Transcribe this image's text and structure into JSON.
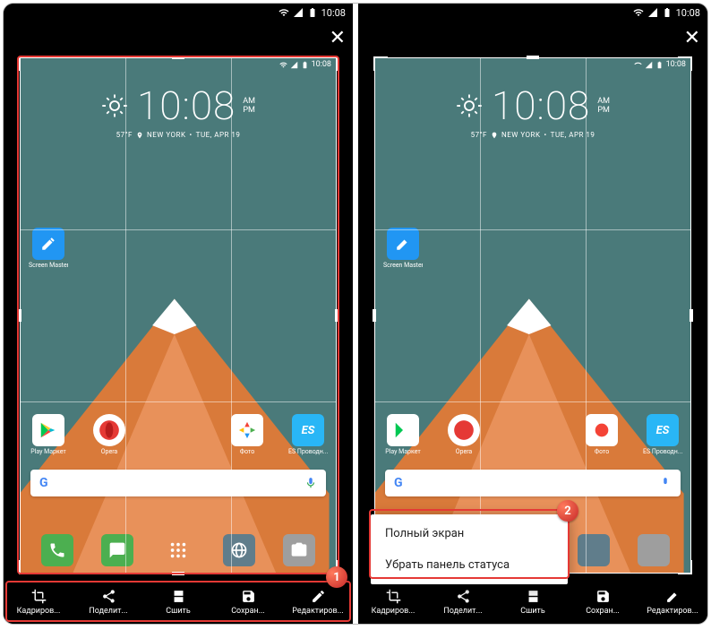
{
  "status": {
    "time": "10:08"
  },
  "inner_status": {
    "time": "10:08"
  },
  "clock": {
    "time": "10:08",
    "am": "AM",
    "pm": "PM",
    "temp": "57°F",
    "city": "NEW YORK",
    "date": "TUE, APR 19"
  },
  "apps": {
    "screen_master": "Screen Master",
    "play": "Play Маркет",
    "opera": "Opera",
    "photo": "Фото",
    "es": "ES Проводн..."
  },
  "toolbar": {
    "crop": "Кадриров...",
    "share": "Поделит...",
    "stitch": "Сшить",
    "save": "Сохран...",
    "edit": "Редактиров..."
  },
  "popup": {
    "fullscreen": "Полный экран",
    "remove_status": "Убрать панель статуса"
  },
  "badges": {
    "one": "1",
    "two": "2"
  }
}
